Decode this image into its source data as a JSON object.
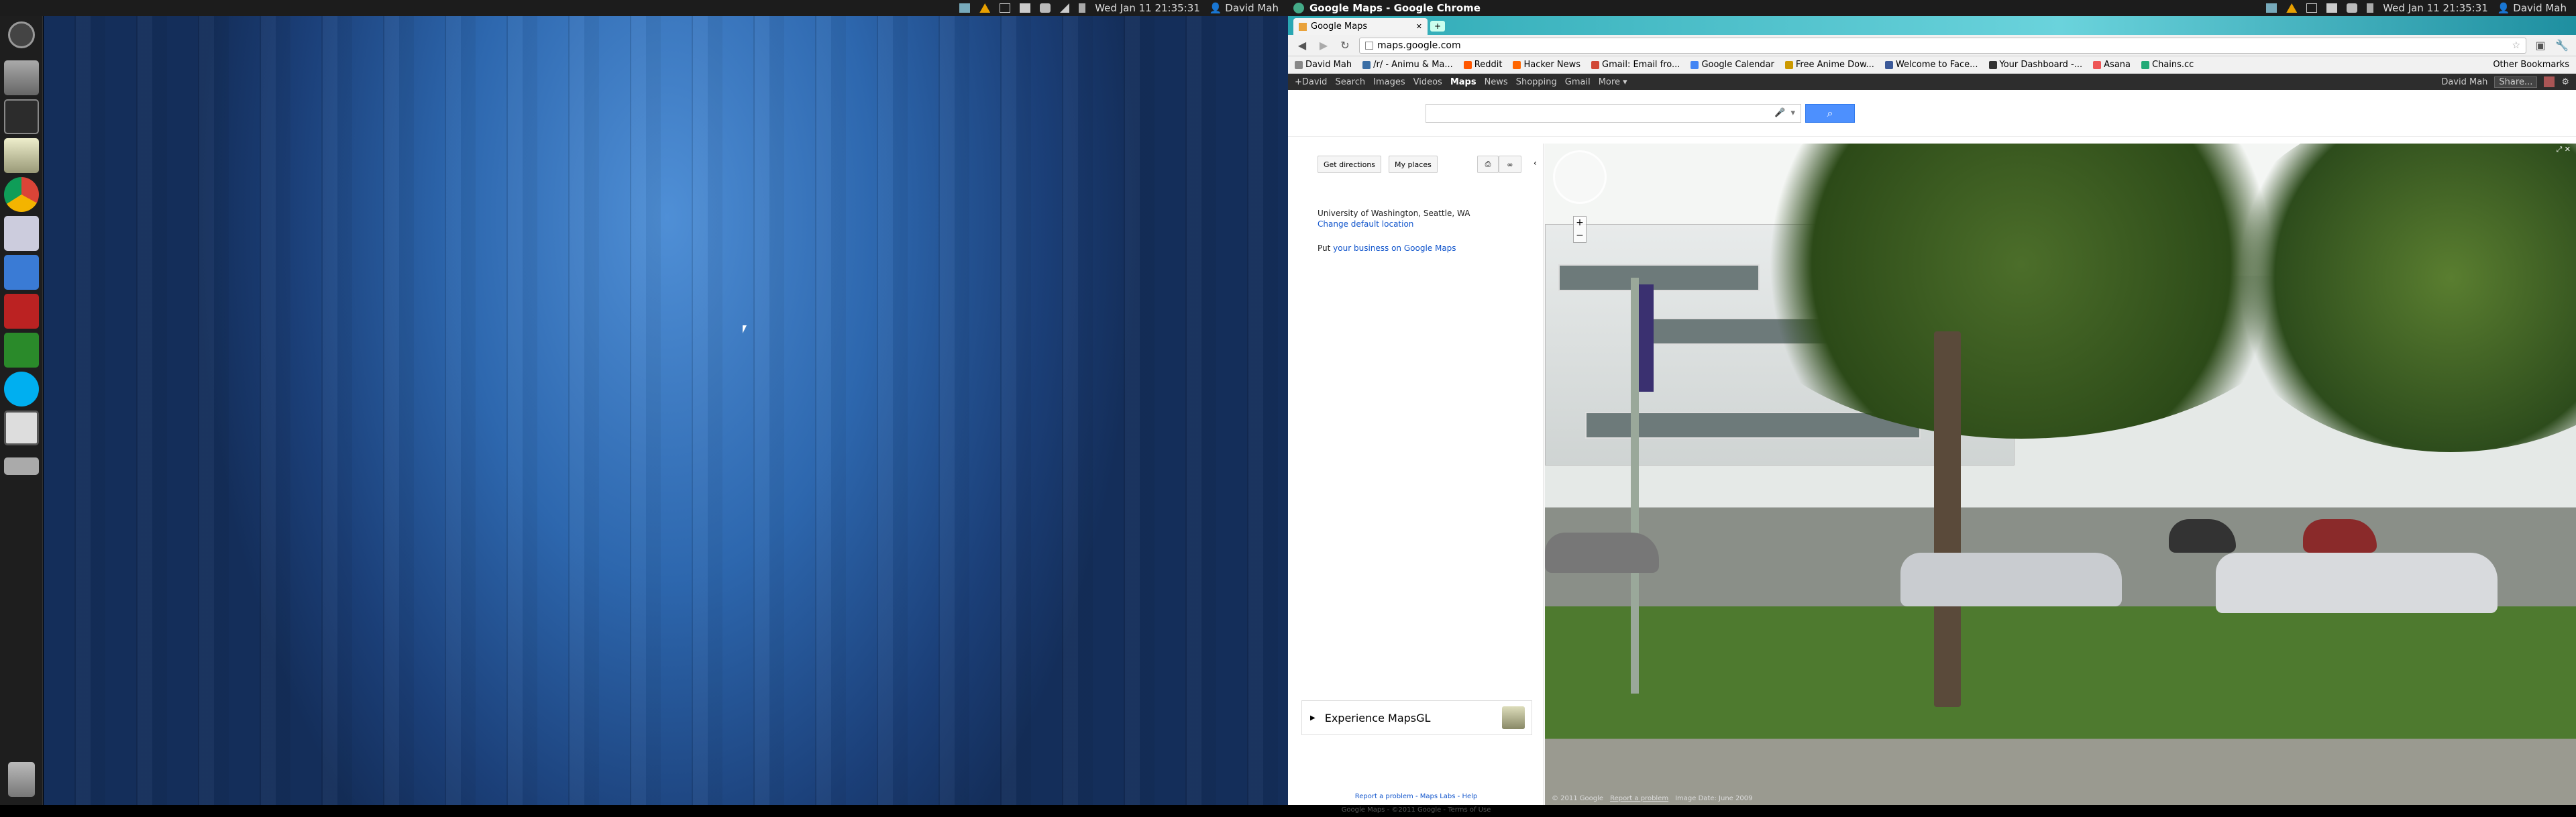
{
  "left_panel": {
    "clock": "Wed Jan 11 21:35:31",
    "user": "David Mah"
  },
  "right_panel": {
    "window_title": "Google Maps - Google Chrome",
    "clock": "Wed Jan 11 21:35:31",
    "user": "David Mah"
  },
  "launcher": {
    "items": [
      "dash-home-icon",
      "home-folder-icon",
      "terminal-icon",
      "gedit-icon",
      "chrome-icon",
      "image-viewer-icon",
      "software-center-icon",
      "media-app-icon",
      "libreoffice-calc-icon",
      "skype-icon",
      "window-app-icon",
      "drive-icon"
    ],
    "trash": "trash-icon"
  },
  "browser": {
    "tab_title": "Google Maps",
    "url": "maps.google.com",
    "bookmarks": [
      {
        "label": "David Mah",
        "color": "#888"
      },
      {
        "label": "/r/ - Animu & Ma...",
        "color": "#3a6ea5"
      },
      {
        "label": "Reddit",
        "color": "#ff5700"
      },
      {
        "label": "Hacker News",
        "color": "#ff6600"
      },
      {
        "label": "Gmail: Email fro...",
        "color": "#d14836"
      },
      {
        "label": "Google Calendar",
        "color": "#4285f4"
      },
      {
        "label": "Free Anime Dow...",
        "color": "#c90"
      },
      {
        "label": "Welcome to Face...",
        "color": "#3b5998"
      },
      {
        "label": "Your Dashboard -...",
        "color": "#333"
      },
      {
        "label": "Asana",
        "color": "#e55"
      },
      {
        "label": "Chains.cc",
        "color": "#2a7"
      }
    ],
    "other_bookmarks": "Other Bookmarks"
  },
  "google_bar": {
    "links": [
      "+David",
      "Search",
      "Images",
      "Videos",
      "Maps",
      "News",
      "Shopping",
      "Gmail",
      "More ▾"
    ],
    "active": "Maps",
    "user": "David Mah",
    "share": "Share..."
  },
  "maps": {
    "get_directions": "Get directions",
    "my_places": "My places",
    "location": "University of Washington, Seattle, WA",
    "change_location": "Change default location",
    "put_prefix": "Put",
    "put_link": "your business on Google Maps",
    "mapsgl": "Experience MapsGL",
    "footer_line1": "Report a problem - Maps Labs - Help",
    "footer_line2": "Google Maps - ©2011 Google - Terms of Use",
    "sv_copyright": "© 2011 Google",
    "sv_report": "Report a problem",
    "sv_date": "Image Date: June 2009"
  },
  "colors": {
    "desktop_blue": "#2d67ae",
    "search_blue": "#4d90fe",
    "link": "#15c"
  }
}
